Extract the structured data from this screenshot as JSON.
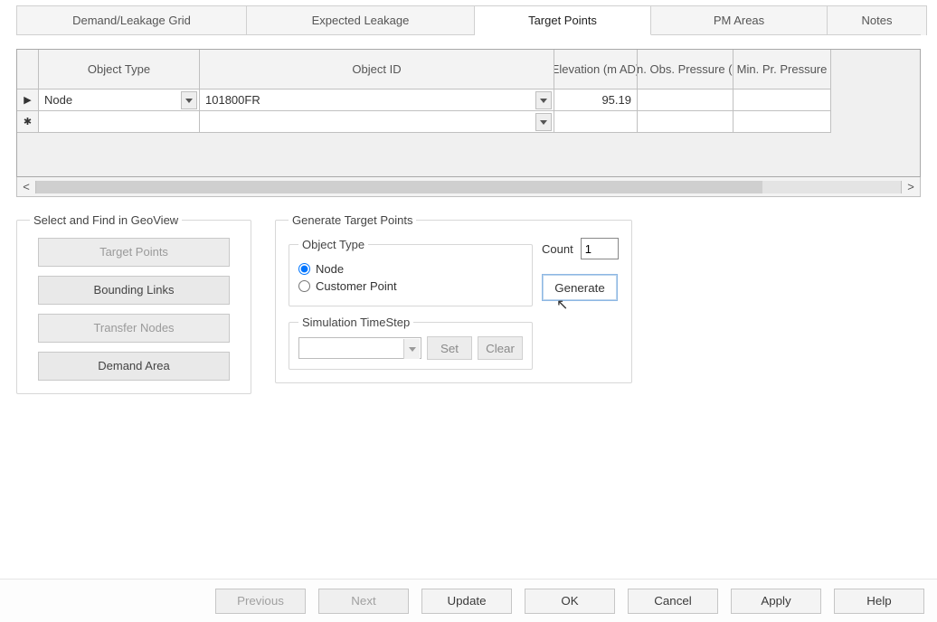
{
  "tabs": [
    {
      "label": "Demand/Leakage Grid",
      "active": false
    },
    {
      "label": "Expected Leakage",
      "active": false
    },
    {
      "label": "Target Points",
      "active": true
    },
    {
      "label": "PM Areas",
      "active": false
    },
    {
      "label": "Notes",
      "active": false
    }
  ],
  "grid": {
    "headers": {
      "object_type": "Object Type",
      "object_id": "Object ID",
      "elevation": "Elevation (m AD)",
      "min_obs": "Min. Obs. Pressure (m)",
      "min_pr": "Min. Pr. Pressure"
    },
    "rows": [
      {
        "object_type": "Node",
        "object_id": "101800FR",
        "elevation": "95.19",
        "min_obs": "",
        "min_pr": ""
      }
    ]
  },
  "geoview": {
    "legend": "Select and Find in GeoView",
    "buttons": [
      {
        "label": "Target Points",
        "enabled": false
      },
      {
        "label": "Bounding Links",
        "enabled": true
      },
      {
        "label": "Transfer Nodes",
        "enabled": false
      },
      {
        "label": "Demand Area",
        "enabled": true
      }
    ]
  },
  "generate": {
    "legend": "Generate Target Points",
    "object_type_legend": "Object Type",
    "radio_node": "Node",
    "radio_customer": "Customer Point",
    "selected": "node",
    "count_label": "Count",
    "count_value": "1",
    "generate_btn": "Generate",
    "sim_legend": "Simulation TimeStep",
    "sim_value": "",
    "set_btn": "Set",
    "clear_btn": "Clear"
  },
  "footer": {
    "previous": "Previous",
    "next": "Next",
    "update": "Update",
    "ok": "OK",
    "cancel": "Cancel",
    "apply": "Apply",
    "help": "Help"
  },
  "glyphs": {
    "row_current": "▶",
    "row_new": "✱"
  }
}
